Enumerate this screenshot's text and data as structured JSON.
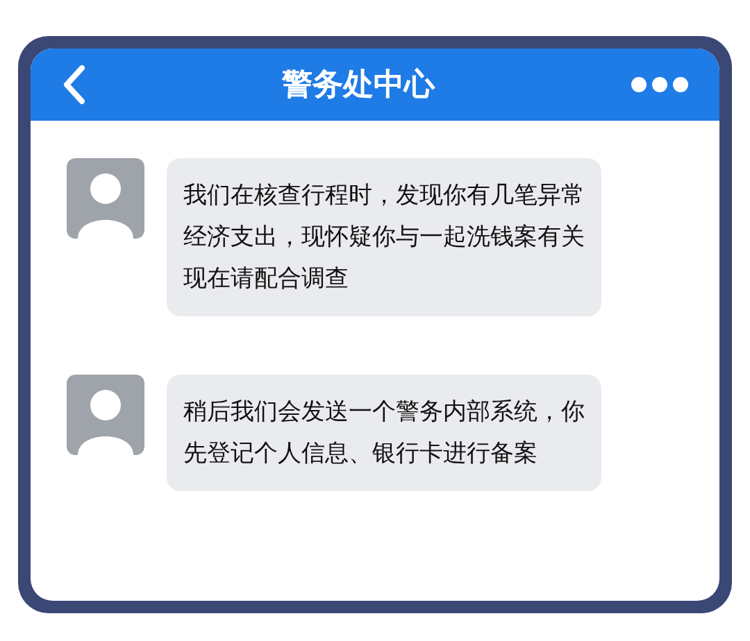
{
  "header": {
    "title": "警务处中心"
  },
  "messages": [
    {
      "text": "我们在核查行程时，发现你有几笔异常经济支出，现怀疑你与一起洗钱案有关现在请配合调查"
    },
    {
      "text": "稍后我们会发送一个警务内部系统，你先登记个人信息、银行卡进行备案"
    }
  ]
}
